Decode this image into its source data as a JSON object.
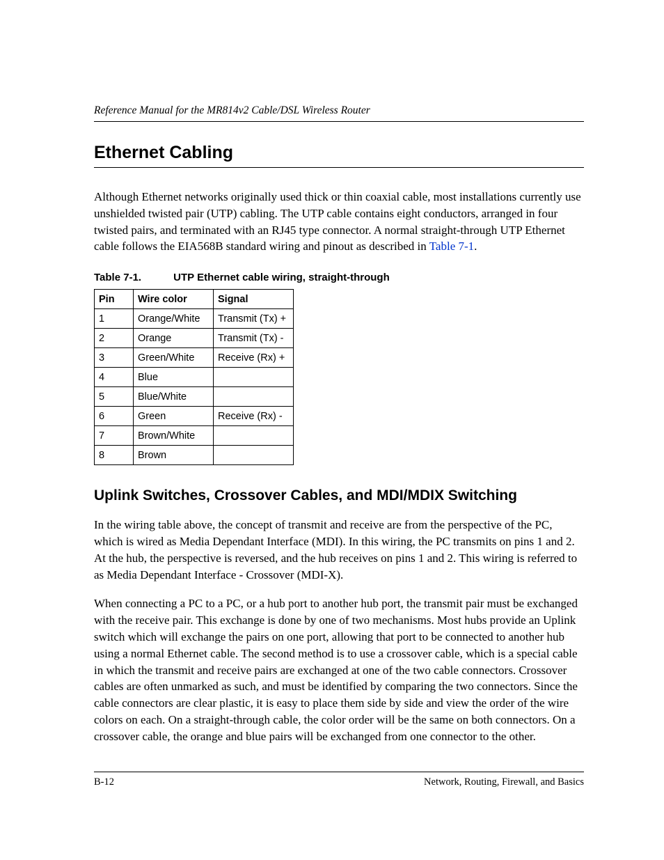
{
  "header": {
    "running": "Reference Manual for the MR814v2 Cable/DSL Wireless Router"
  },
  "section": {
    "title": "Ethernet Cabling",
    "intro_pre": "Although Ethernet networks originally used thick or thin coaxial cable, most installations currently use unshielded twisted pair (UTP) cabling. The UTP cable contains eight conductors, arranged in four twisted pairs, and terminated with an RJ45 type connector. A normal straight-through UTP Ethernet cable follows the EIA568B standard wiring and pinout as described in ",
    "intro_link": "Table 7-1",
    "intro_post": "."
  },
  "table": {
    "caption_number": "Table 7-1.",
    "caption_title": "UTP Ethernet cable wiring, straight-through",
    "headers": {
      "pin": "Pin",
      "color": "Wire color",
      "signal": "Signal"
    },
    "rows": [
      {
        "pin": "1",
        "color": "Orange/White",
        "signal": "Transmit (Tx) +"
      },
      {
        "pin": "2",
        "color": "Orange",
        "signal": "Transmit (Tx) -"
      },
      {
        "pin": "3",
        "color": "Green/White",
        "signal": "Receive (Rx) +"
      },
      {
        "pin": "4",
        "color": "Blue",
        "signal": ""
      },
      {
        "pin": "5",
        "color": "Blue/White",
        "signal": ""
      },
      {
        "pin": "6",
        "color": "Green",
        "signal": "Receive (Rx) -"
      },
      {
        "pin": "7",
        "color": "Brown/White",
        "signal": ""
      },
      {
        "pin": "8",
        "color": "Brown",
        "signal": ""
      }
    ]
  },
  "subsection": {
    "title": "Uplink Switches, Crossover Cables, and MDI/MDIX Switching",
    "p1": "In the wiring table above, the concept of transmit and receive are from the perspective of the PC, which is wired as Media Dependant Interface (MDI). In this wiring, the PC transmits on pins 1 and 2. At the hub, the perspective is reversed, and the hub receives on pins 1 and 2. This wiring is referred to as Media Dependant Interface - Crossover (MDI-X).",
    "p2": "When connecting a PC to a PC, or a hub port to another hub port, the transmit pair must be exchanged with the receive pair. This exchange is done by one of two mechanisms. Most hubs provide an Uplink switch which will exchange the pairs on one port, allowing that port to be connected to another hub using a normal Ethernet cable. The second method is to use a crossover cable, which is a special cable in which the transmit and receive pairs are exchanged at one of the two cable connectors. Crossover cables are often unmarked as such, and must be identified by comparing the two connectors. Since the cable connectors are clear plastic, it is easy to place them side by side and view the order of the wire colors on each. On a straight-through cable, the color order will be the same on both connectors. On a crossover cable, the orange and blue pairs will be exchanged from one connector to the other."
  },
  "footer": {
    "page_number": "B-12",
    "section_label": "Network, Routing, Firewall, and Basics"
  }
}
